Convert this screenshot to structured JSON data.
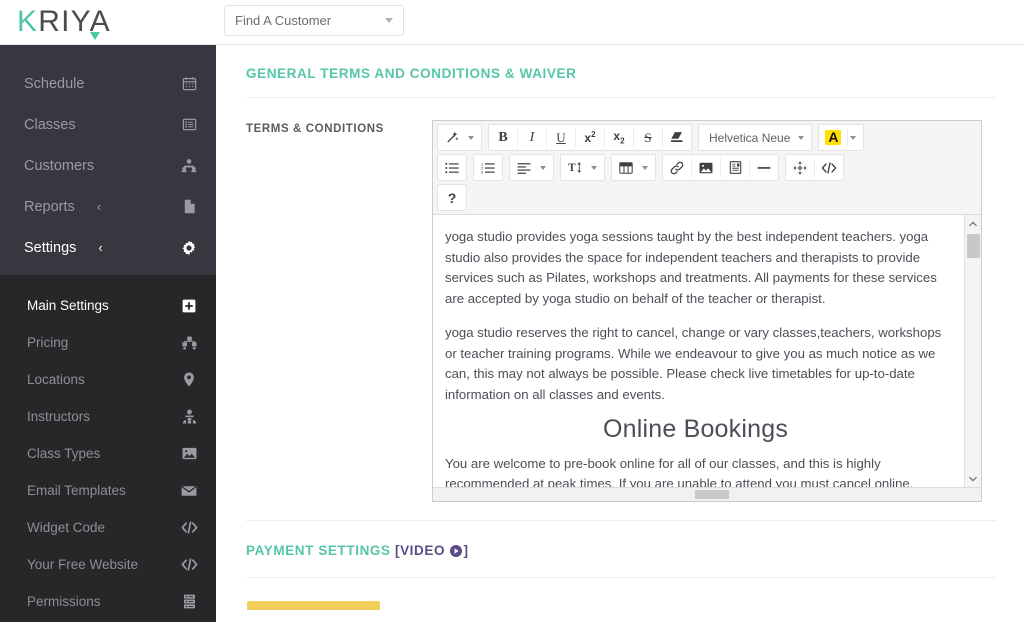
{
  "brand": {
    "text_left": "K",
    "text_right": "RIY",
    "text_end": "A",
    "full": "KRIYA"
  },
  "header": {
    "customer_select": {
      "value": "Find A Customer",
      "icon": "chevron-down-icon"
    }
  },
  "sidebar": {
    "main_items": [
      {
        "label": "Schedule",
        "icon": "calendar-icon",
        "caret": "",
        "active": false
      },
      {
        "label": "Classes",
        "icon": "list-box-icon",
        "caret": "",
        "active": false
      },
      {
        "label": "Customers",
        "icon": "customers-icon",
        "caret": "",
        "active": false
      },
      {
        "label": "Reports",
        "icon": "document-icon",
        "caret": "‹",
        "active": false
      },
      {
        "label": "Settings",
        "icon": "gear-icon",
        "caret": "‹",
        "active": true
      }
    ],
    "sub_items": [
      {
        "label": "Main Settings",
        "icon": "plus-square-icon",
        "active": true
      },
      {
        "label": "Pricing",
        "icon": "pricing-icon",
        "active": false
      },
      {
        "label": "Locations",
        "icon": "map-pin-icon",
        "active": false
      },
      {
        "label": "Instructors",
        "icon": "instructor-icon",
        "active": false
      },
      {
        "label": "Class Types",
        "icon": "image-icon",
        "active": false
      },
      {
        "label": "Email Templates",
        "icon": "envelope-icon",
        "active": false
      },
      {
        "label": "Widget Code",
        "icon": "code-icon",
        "active": false
      },
      {
        "label": "Your Free Website",
        "icon": "code-icon",
        "active": false
      },
      {
        "label": "Permissions",
        "icon": "permissions-icon",
        "active": false
      }
    ]
  },
  "main": {
    "terms_section": {
      "title": "GENERAL TERMS AND CONDITIONS & WAIVER",
      "field_label": "TERMS & CONDITIONS"
    },
    "payment_section": {
      "title": "PAYMENT SETTINGS",
      "video_open": "[VIDEO",
      "video_close": "]",
      "video_icon": "play-circle-icon"
    }
  },
  "editor": {
    "toolbar": {
      "row1": [
        {
          "name": "magic-wand-icon",
          "glyph": "wand",
          "caret": true
        },
        {
          "name": "bold-icon",
          "glyph": "B",
          "caret": false
        },
        {
          "name": "italic-icon",
          "glyph": "I",
          "caret": false
        },
        {
          "name": "underline-icon",
          "glyph": "U",
          "caret": false
        },
        {
          "name": "superscript-icon",
          "glyph": "x2sup",
          "caret": false
        },
        {
          "name": "subscript-icon",
          "glyph": "x2sub",
          "caret": false
        },
        {
          "name": "strikethrough-icon",
          "glyph": "S",
          "caret": false
        },
        {
          "name": "clear-formatting-icon",
          "glyph": "eraser",
          "caret": false
        }
      ],
      "font_family": {
        "label": "Helvetica Neue",
        "icon": "chevron-down-icon"
      },
      "text_color": {
        "label": "A",
        "icon": "text-color-icon",
        "highlight": "#ffe000"
      },
      "row2": [
        {
          "name": "unordered-list-icon",
          "caret": false
        },
        {
          "name": "ordered-list-icon",
          "caret": false
        },
        {
          "name": "align-left-icon",
          "caret": true
        },
        {
          "name": "line-height-icon",
          "caret": true
        },
        {
          "name": "table-icon",
          "caret": true
        },
        {
          "name": "insert-link-icon",
          "caret": false
        },
        {
          "name": "insert-image-icon",
          "caret": false
        },
        {
          "name": "insert-file-icon",
          "caret": false
        },
        {
          "name": "horizontal-rule-icon",
          "caret": false
        },
        {
          "name": "fullscreen-icon",
          "caret": false
        },
        {
          "name": "code-view-icon",
          "caret": false
        }
      ],
      "row3": [
        {
          "name": "help-icon",
          "glyph": "?",
          "caret": false
        }
      ]
    },
    "content": {
      "paragraph1": "yoga studio provides yoga sessions taught by the best independent teachers. yoga studio also provides the space for independent teachers and therapists to provide services such as Pilates, workshops and treatments. All payments for these services are accepted by yoga studio on behalf of the teacher or therapist.",
      "paragraph2": "yoga studio reserves the right to cancel, change or vary classes,teachers, workshops or teacher training programs. While we endeavour to give you as much notice as we can, this may not always be possible. Please check live timetables for up-to-date information on all classes and events.",
      "heading": "Online Bookings",
      "paragraph3": "You are welcome to pre-book online for all of our classes, and this is highly recommended at peak times. If you are unable to attend you must cancel online. Failure to cancel or “no-show”"
    },
    "scroll": {
      "up_arrow": "⌃",
      "down_arrow": "⌄"
    }
  },
  "colors": {
    "accent_teal": "#56c6a9",
    "sidebar_bg": "#373740",
    "submenu_bg": "#272729",
    "video_purple": "#5b4b87",
    "button_yellow": "#f2cf5b"
  }
}
